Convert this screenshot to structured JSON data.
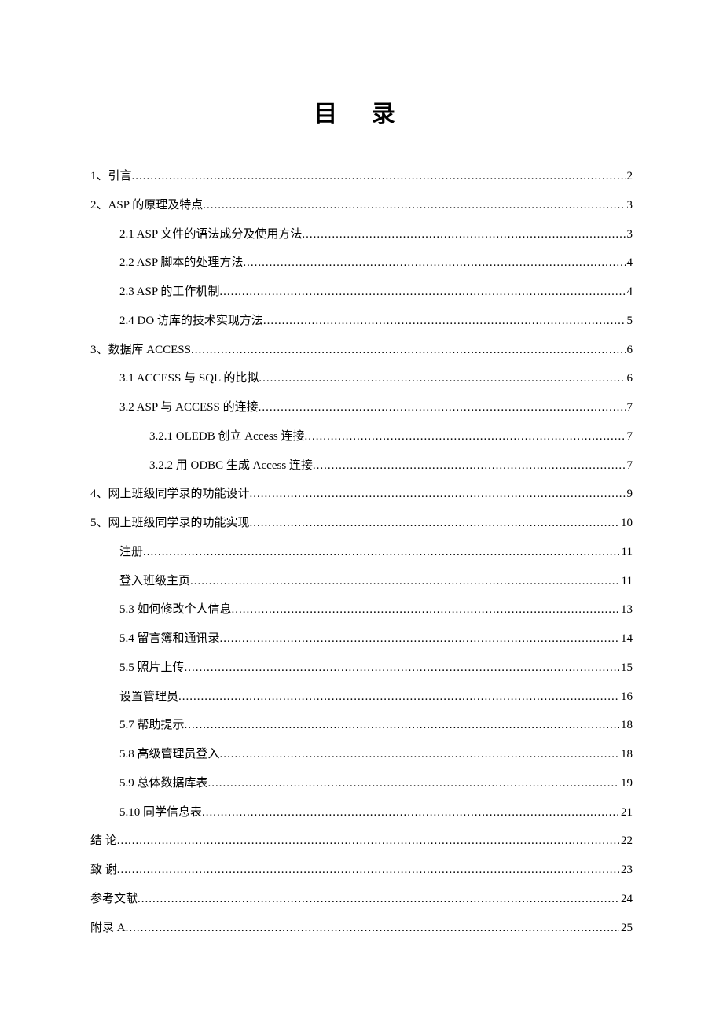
{
  "title": "目 录",
  "entries": [
    {
      "label": "1、引言",
      "page": "2",
      "indent": 0
    },
    {
      "label": "2、ASP 的原理及特点",
      "page": "3",
      "indent": 0
    },
    {
      "label": "2.1 ASP 文件的语法成分及使用方法",
      "page": "3",
      "indent": 1
    },
    {
      "label": "2.2 ASP 脚本的处理方法",
      "page": "4",
      "indent": 1
    },
    {
      "label": "2.3 ASP 的工作机制",
      "page": "4",
      "indent": 1
    },
    {
      "label": "2.4 DO 访库的技术实现方法",
      "page": "5",
      "indent": 1
    },
    {
      "label": "3、数据库 ACCESS",
      "page": "6",
      "indent": 0
    },
    {
      "label": "3.1 ACCESS 与 SQL 的比拟",
      "page": "6",
      "indent": 1
    },
    {
      "label": "3.2 ASP 与 ACCESS 的连接",
      "page": "7",
      "indent": 1
    },
    {
      "label": "3.2.1 OLEDB 创立 Access 连接",
      "page": "7",
      "indent": 2
    },
    {
      "label": "3.2.2 用 ODBC 生成 Access 连接",
      "page": "7",
      "indent": 2
    },
    {
      "label": "4、网上班级同学录的功能设计",
      "page": "9",
      "indent": 0
    },
    {
      "label": "5、网上班级同学录的功能实现",
      "page": "10",
      "indent": 0
    },
    {
      "label": "注册",
      "page": "11",
      "indent": 1
    },
    {
      "label": "登入班级主页",
      "page": "11",
      "indent": 1
    },
    {
      "label": "5.3 如何修改个人信息",
      "page": "13",
      "indent": 1
    },
    {
      "label": "5.4 留言簿和通讯录",
      "page": "14",
      "indent": 1
    },
    {
      "label": "5.5 照片上传",
      "page": "15",
      "indent": 1
    },
    {
      "label": "设置管理员",
      "page": "16",
      "indent": 1
    },
    {
      "label": "5.7 帮助提示",
      "page": "18",
      "indent": 1
    },
    {
      "label": "5.8 高级管理员登入",
      "page": "18",
      "indent": 1
    },
    {
      "label": "5.9 总体数据库表",
      "page": "19",
      "indent": 1
    },
    {
      "label": "5.10 同学信息表",
      "page": "21",
      "indent": 1
    },
    {
      "label": "结  论",
      "page": "22",
      "indent": 0
    },
    {
      "label": "致  谢",
      "page": "23",
      "indent": 0
    },
    {
      "label": "参考文献",
      "page": "24",
      "indent": 0
    },
    {
      "label": "附录 A",
      "page": "25",
      "indent": 0
    }
  ]
}
